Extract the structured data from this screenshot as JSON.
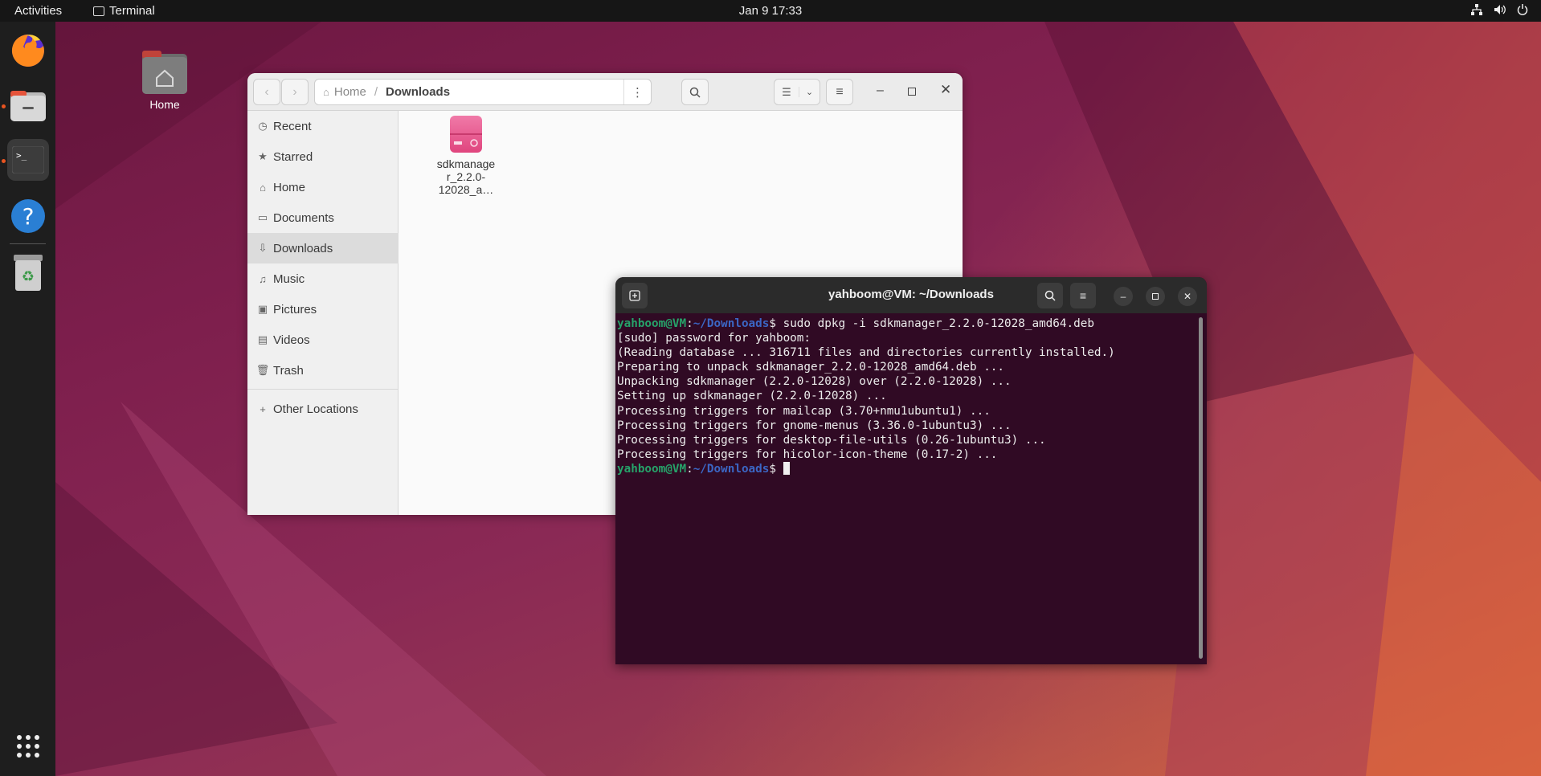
{
  "topbar": {
    "activities": "Activities",
    "app_name": "Terminal",
    "clock": "Jan 9  17:33"
  },
  "dock": {
    "items": [
      "firefox-icon",
      "files-icon",
      "terminal-icon",
      "help-icon",
      "trash-icon",
      "show-apps-icon"
    ]
  },
  "desktop": {
    "home_label": "Home"
  },
  "files": {
    "breadcrumb": [
      "Home",
      "Downloads"
    ],
    "sidebar": [
      {
        "label": "Recent",
        "icon": "clock-icon"
      },
      {
        "label": "Starred",
        "icon": "star-icon"
      },
      {
        "label": "Home",
        "icon": "home-icon"
      },
      {
        "label": "Documents",
        "icon": "document-icon"
      },
      {
        "label": "Downloads",
        "icon": "download-icon"
      },
      {
        "label": "Music",
        "icon": "music-icon"
      },
      {
        "label": "Pictures",
        "icon": "picture-icon"
      },
      {
        "label": "Videos",
        "icon": "video-icon"
      },
      {
        "label": "Trash",
        "icon": "trash-icon"
      },
      {
        "label": "Other Locations",
        "icon": "plus-icon"
      }
    ],
    "file": {
      "line1": "sdkmanage",
      "line2": "r_2.2.0-",
      "line3": "12028_a…"
    }
  },
  "terminal": {
    "title": "yahboom@VM: ~/Downloads",
    "prompt_user": "yahboom@VM",
    "prompt_path": "~/Downloads",
    "command": "sudo dpkg -i sdkmanager_2.2.0-12028_amd64.deb",
    "lines": [
      "[sudo] password for yahboom:",
      "(Reading database ... 316711 files and directories currently installed.)",
      "Preparing to unpack sdkmanager_2.2.0-12028_amd64.deb ...",
      "Unpacking sdkmanager (2.2.0-12028) over (2.2.0-12028) ...",
      "Setting up sdkmanager (2.2.0-12028) ...",
      "Processing triggers for mailcap (3.70+nmu1ubuntu1) ...",
      "Processing triggers for gnome-menus (3.36.0-1ubuntu3) ...",
      "Processing triggers for desktop-file-utils (0.26-1ubuntu3) ...",
      "Processing triggers for hicolor-icon-theme (0.17-2) ..."
    ]
  }
}
